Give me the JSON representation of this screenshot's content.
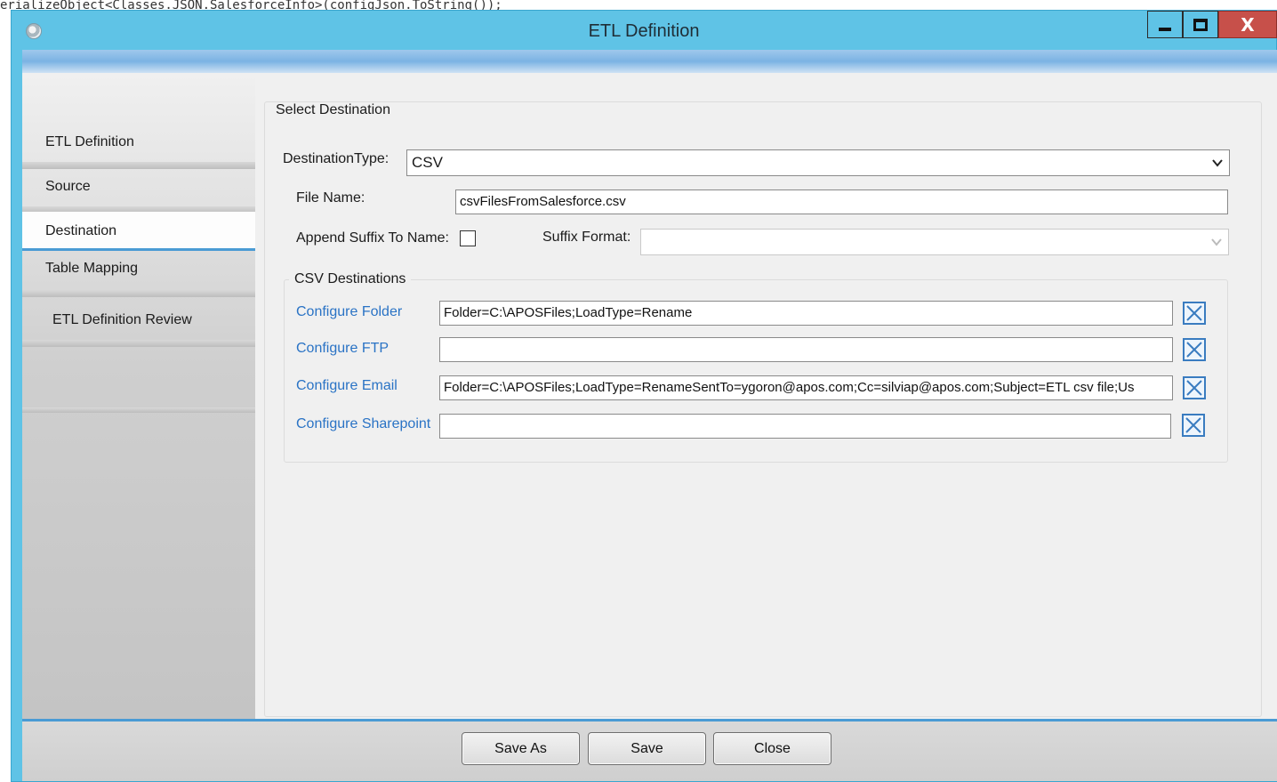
{
  "background_code": "erializeObject<Classes.JSON.SalesforceInfo>(configJson.ToString());",
  "window": {
    "title": "ETL Definition",
    "minimize_label": "Minimize",
    "maximize_label": "Maximize",
    "close_glyph": "X"
  },
  "sidebar": {
    "items": [
      {
        "label": "ETL Definition",
        "active": false
      },
      {
        "label": "Source",
        "active": false
      },
      {
        "label": "Destination",
        "active": true
      },
      {
        "label": "Table Mapping",
        "active": false
      },
      {
        "label": "ETL Definition Review",
        "active": false
      }
    ]
  },
  "destination": {
    "group_title": "Select Destination",
    "type_label": "DestinationType:",
    "type_value": "CSV",
    "file_name_label": "File Name:",
    "file_name_value": "csvFilesFromSalesforce.csv",
    "append_suffix_label": "Append Suffix To Name:",
    "append_suffix_checked": false,
    "suffix_format_label": "Suffix Format:",
    "suffix_format_value": ""
  },
  "csv_destinations": {
    "group_title": "CSV Destinations",
    "rows": [
      {
        "label": "Configure Folder",
        "value": "Folder=C:\\APOSFiles;LoadType=Rename"
      },
      {
        "label": "Configure FTP",
        "value": ""
      },
      {
        "label": "Configure Email",
        "value": "Folder=C:\\APOSFiles;LoadType=RenameSentTo=ygoron@apos.com;Cc=silviap@apos.com;Subject=ETL csv file;Us"
      },
      {
        "label": "Configure Sharepoint",
        "value": ""
      }
    ]
  },
  "footer": {
    "save_as_label": "Save As",
    "save_label": "Save",
    "close_label": "Close"
  },
  "colors": {
    "title_bar": "#5fc3e6",
    "accent": "#4a9bd4",
    "link": "#2a73c5",
    "close_button": "#c7504a"
  }
}
